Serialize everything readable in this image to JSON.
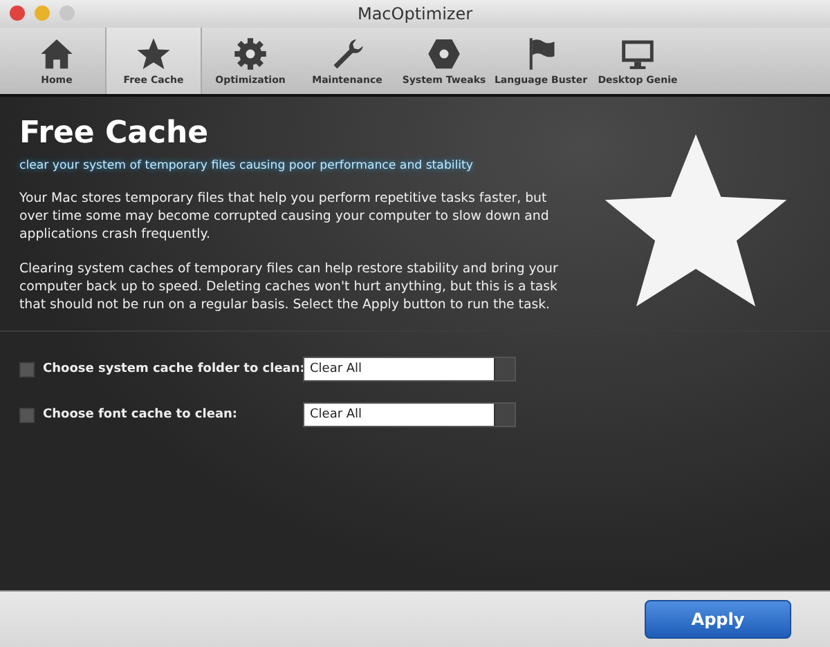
{
  "window": {
    "title": "MacOptimizer"
  },
  "tabs": [
    {
      "label": "Home",
      "selected": false
    },
    {
      "label": "Free Cache",
      "selected": true
    },
    {
      "label": "Optimization",
      "selected": false
    },
    {
      "label": "Maintenance",
      "selected": false
    },
    {
      "label": "System Tweaks",
      "selected": false
    },
    {
      "label": "Language Buster",
      "selected": false
    },
    {
      "label": "Desktop Genie",
      "selected": false
    }
  ],
  "page": {
    "title": "Free Cache",
    "subtitle": "clear your system of temporary files causing poor performance and stability",
    "paragraphs": [
      "Your Mac stores temporary files that help you perform repetitive tasks faster, but over time some may become corrupted causing your computer to slow down and applications crash frequently.",
      "Clearing system caches of temporary files can help restore stability and bring your computer back up to speed. Deleting caches won't hurt anything, but this is a task that should not be run on a regular basis. Select the Apply button to run the task."
    ]
  },
  "options": [
    {
      "label": "Choose system cache folder to clean:",
      "checked": false,
      "value": "Clear All"
    },
    {
      "label": "Choose font cache to clean:",
      "checked": false,
      "value": "Clear All"
    }
  ],
  "buttons": [
    {
      "label": "Apply"
    }
  ]
}
